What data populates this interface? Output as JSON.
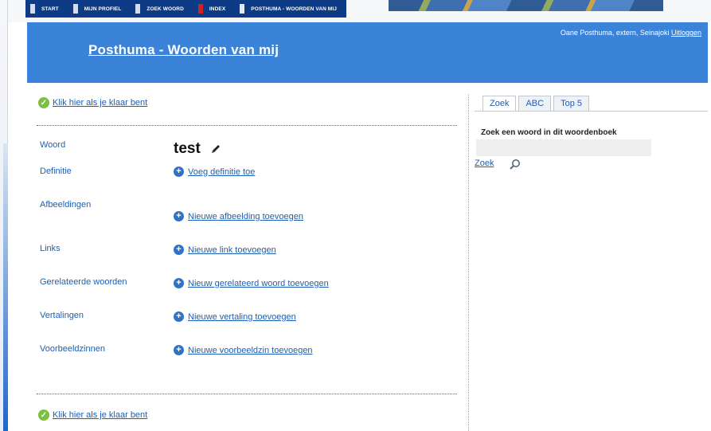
{
  "nav": {
    "items": [
      {
        "label": "START"
      },
      {
        "label": "MIJN PROFIEL"
      },
      {
        "label": "ZOEK WOORD"
      },
      {
        "label": "INDEX"
      },
      {
        "label": "POSTHUMA - WOORDEN VAN MIJ"
      }
    ]
  },
  "header": {
    "user_text": "Oane Posthuma, extern, Seinajoki",
    "logout_label": "Uitloggen",
    "page_title": "Posthuma - Woorden van mij"
  },
  "main": {
    "done_link_top": "Klik hier als je klaar bent",
    "done_link_bottom": "Klik hier als je klaar bent",
    "fields": {
      "word_label": "Woord",
      "word_value": "test",
      "definition_label": "Definitie",
      "definition_action": "Voeg definitie toe",
      "images_label": "Afbeeldingen",
      "images_action": "Nieuwe afbeelding toevoegen",
      "links_label": "Links",
      "links_action": "Nieuwe link toevoegen",
      "related_label": "Gerelateerde woorden",
      "related_action": "Nieuw gerelateerd woord toevoegen",
      "translations_label": "Vertalingen",
      "translations_action": "Nieuwe vertaling toevoegen",
      "examples_label": "Voorbeeldzinnen",
      "examples_action": "Nieuwe voorbeeldzin toevoegen"
    }
  },
  "sidebar": {
    "tabs": [
      {
        "label": "Zoek"
      },
      {
        "label": "ABC"
      },
      {
        "label": "Top 5"
      }
    ],
    "search_title": "Zoek een woord in dit woordenboek",
    "search_value": "",
    "search_link": "Zoek"
  },
  "colors": {
    "header_bg": "#3b83d9",
    "nav_bg": "#0d3b86",
    "link": "#1d5fb4",
    "check_green": "#7ac13f"
  }
}
